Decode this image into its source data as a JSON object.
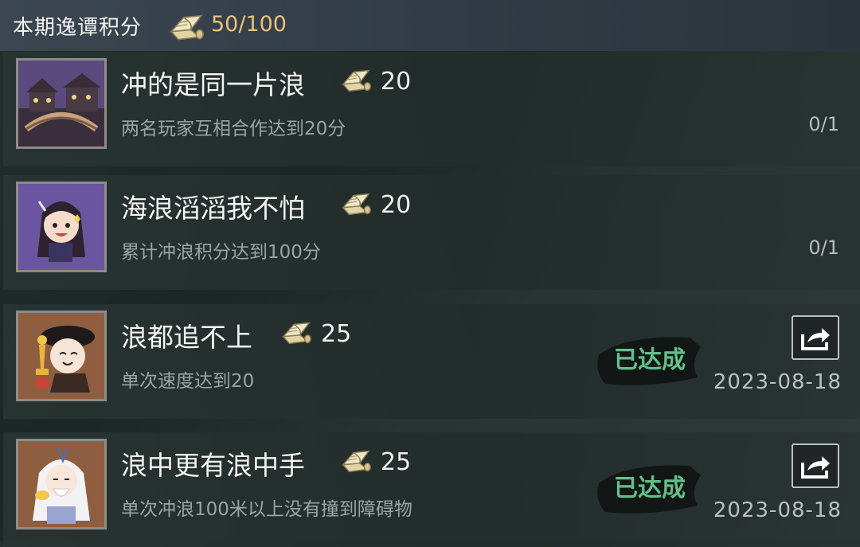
{
  "header": {
    "title": "本期逸谭积分",
    "score": "50/100",
    "icon": "scroll-icon"
  },
  "achievements": [
    {
      "title": "冲的是同一片浪",
      "points": "20",
      "description": "两名玩家互相合作达到20分",
      "progress": "0/1",
      "completed": false,
      "icon": "bridge-scene-icon"
    },
    {
      "title": "海浪滔滔我不怕",
      "points": "20",
      "description": "累计冲浪积分达到100分",
      "progress": "0/1",
      "completed": false,
      "icon": "character-girl-icon"
    },
    {
      "title": "浪都追不上",
      "points": "25",
      "description": "单次速度达到20",
      "date": "2023-08-18",
      "completed": true,
      "stamp": "已达成",
      "icon": "character-trophy-icon"
    },
    {
      "title": "浪中更有浪中手",
      "points": "25",
      "description": "单次冲浪100米以上没有撞到障碍物",
      "date": "2023-08-18",
      "completed": true,
      "stamp": "已达成",
      "icon": "character-elder-icon"
    }
  ],
  "colors": {
    "score": "#e8c27b",
    "stamp": "#63c08a",
    "frame_purple": "#5e4e86",
    "frame_brown": "#8a5a3f"
  }
}
